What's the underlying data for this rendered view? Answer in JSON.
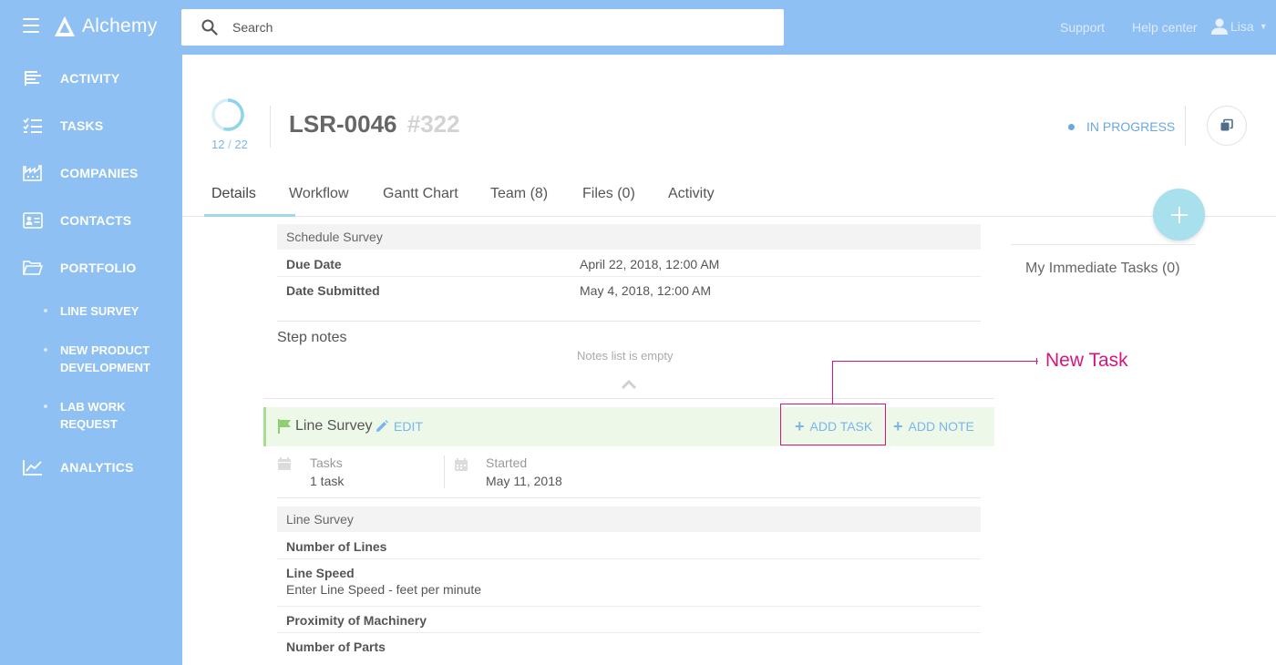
{
  "app": {
    "name": "Alchemy"
  },
  "search": {
    "placeholder": "Search"
  },
  "top_links": {
    "support": "Support",
    "help": "Help center",
    "user": "Lisa"
  },
  "sidebar": {
    "items": [
      {
        "label": "ACTIVITY",
        "icon": "activity-icon"
      },
      {
        "label": "TASKS",
        "icon": "tasks-icon"
      },
      {
        "label": "COMPANIES",
        "icon": "companies-icon"
      },
      {
        "label": "CONTACTS",
        "icon": "contacts-icon"
      },
      {
        "label": "PORTFOLIO",
        "icon": "folder-icon"
      }
    ],
    "portfolio_children": [
      {
        "label": "LINE SURVEY"
      },
      {
        "label": "NEW PRODUCT DEVELOPMENT"
      },
      {
        "label": "LAB WORK REQUEST"
      }
    ],
    "analytics": {
      "label": "ANALYTICS",
      "icon": "analytics-icon"
    }
  },
  "project": {
    "progress_done": "12",
    "progress_total": "22",
    "progress_fraction": 0.545,
    "code": "LSR-0046",
    "number": "#322",
    "status": "IN PROGRESS",
    "status_color": "#6aa7e3"
  },
  "tabs": [
    {
      "label": "Details",
      "active": true
    },
    {
      "label": "Workflow"
    },
    {
      "label": "Gantt Chart"
    },
    {
      "label": "Team (8)"
    },
    {
      "label": "Files (0)"
    },
    {
      "label": "Activity"
    }
  ],
  "right_panel": {
    "immediate_tasks": "My Immediate Tasks (0)"
  },
  "schedule": {
    "title": "Schedule Survey",
    "rows": [
      {
        "label": "Due Date",
        "value": "April 22, 2018, 12:00 AM"
      },
      {
        "label": "Date Submitted",
        "value": "May 4, 2018, 12:00 AM"
      }
    ]
  },
  "notes": {
    "title": "Step notes",
    "empty": "Notes list is empty"
  },
  "step": {
    "name": "Line Survey",
    "edit": "EDIT",
    "add_task": "ADD TASK",
    "add_note": "ADD NOTE",
    "tasks_label": "Tasks",
    "tasks_value": "1 task",
    "started_label": "Started",
    "started_value": "May 11, 2018"
  },
  "annotation": {
    "text": "New Task",
    "color": "#d6167f"
  },
  "line_survey": {
    "title": "Line Survey",
    "fields": [
      {
        "label": "Number of Lines"
      },
      {
        "label": "Line Speed",
        "sub": "Enter Line Speed - feet per minute"
      },
      {
        "label": "Proximity of Machinery"
      },
      {
        "label": "Number of Parts"
      }
    ]
  },
  "colors": {
    "brand": "#8ec0f4",
    "accent": "#79b6ea",
    "fab": "#a9e0ee",
    "step_bar": "#eef8e9"
  }
}
